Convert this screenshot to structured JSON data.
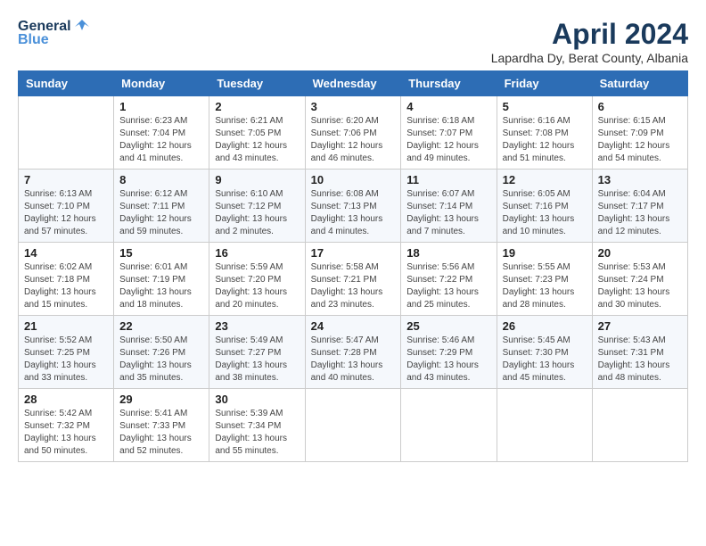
{
  "header": {
    "logo_line1": "General",
    "logo_line2": "Blue",
    "title": "April 2024",
    "subtitle": "Lapardha Dy, Berat County, Albania"
  },
  "calendar": {
    "days_of_week": [
      "Sunday",
      "Monday",
      "Tuesday",
      "Wednesday",
      "Thursday",
      "Friday",
      "Saturday"
    ],
    "weeks": [
      [
        {
          "day": "",
          "info": ""
        },
        {
          "day": "1",
          "info": "Sunrise: 6:23 AM\nSunset: 7:04 PM\nDaylight: 12 hours\nand 41 minutes."
        },
        {
          "day": "2",
          "info": "Sunrise: 6:21 AM\nSunset: 7:05 PM\nDaylight: 12 hours\nand 43 minutes."
        },
        {
          "day": "3",
          "info": "Sunrise: 6:20 AM\nSunset: 7:06 PM\nDaylight: 12 hours\nand 46 minutes."
        },
        {
          "day": "4",
          "info": "Sunrise: 6:18 AM\nSunset: 7:07 PM\nDaylight: 12 hours\nand 49 minutes."
        },
        {
          "day": "5",
          "info": "Sunrise: 6:16 AM\nSunset: 7:08 PM\nDaylight: 12 hours\nand 51 minutes."
        },
        {
          "day": "6",
          "info": "Sunrise: 6:15 AM\nSunset: 7:09 PM\nDaylight: 12 hours\nand 54 minutes."
        }
      ],
      [
        {
          "day": "7",
          "info": "Sunrise: 6:13 AM\nSunset: 7:10 PM\nDaylight: 12 hours\nand 57 minutes."
        },
        {
          "day": "8",
          "info": "Sunrise: 6:12 AM\nSunset: 7:11 PM\nDaylight: 12 hours\nand 59 minutes."
        },
        {
          "day": "9",
          "info": "Sunrise: 6:10 AM\nSunset: 7:12 PM\nDaylight: 13 hours\nand 2 minutes."
        },
        {
          "day": "10",
          "info": "Sunrise: 6:08 AM\nSunset: 7:13 PM\nDaylight: 13 hours\nand 4 minutes."
        },
        {
          "day": "11",
          "info": "Sunrise: 6:07 AM\nSunset: 7:14 PM\nDaylight: 13 hours\nand 7 minutes."
        },
        {
          "day": "12",
          "info": "Sunrise: 6:05 AM\nSunset: 7:16 PM\nDaylight: 13 hours\nand 10 minutes."
        },
        {
          "day": "13",
          "info": "Sunrise: 6:04 AM\nSunset: 7:17 PM\nDaylight: 13 hours\nand 12 minutes."
        }
      ],
      [
        {
          "day": "14",
          "info": "Sunrise: 6:02 AM\nSunset: 7:18 PM\nDaylight: 13 hours\nand 15 minutes."
        },
        {
          "day": "15",
          "info": "Sunrise: 6:01 AM\nSunset: 7:19 PM\nDaylight: 13 hours\nand 18 minutes."
        },
        {
          "day": "16",
          "info": "Sunrise: 5:59 AM\nSunset: 7:20 PM\nDaylight: 13 hours\nand 20 minutes."
        },
        {
          "day": "17",
          "info": "Sunrise: 5:58 AM\nSunset: 7:21 PM\nDaylight: 13 hours\nand 23 minutes."
        },
        {
          "day": "18",
          "info": "Sunrise: 5:56 AM\nSunset: 7:22 PM\nDaylight: 13 hours\nand 25 minutes."
        },
        {
          "day": "19",
          "info": "Sunrise: 5:55 AM\nSunset: 7:23 PM\nDaylight: 13 hours\nand 28 minutes."
        },
        {
          "day": "20",
          "info": "Sunrise: 5:53 AM\nSunset: 7:24 PM\nDaylight: 13 hours\nand 30 minutes."
        }
      ],
      [
        {
          "day": "21",
          "info": "Sunrise: 5:52 AM\nSunset: 7:25 PM\nDaylight: 13 hours\nand 33 minutes."
        },
        {
          "day": "22",
          "info": "Sunrise: 5:50 AM\nSunset: 7:26 PM\nDaylight: 13 hours\nand 35 minutes."
        },
        {
          "day": "23",
          "info": "Sunrise: 5:49 AM\nSunset: 7:27 PM\nDaylight: 13 hours\nand 38 minutes."
        },
        {
          "day": "24",
          "info": "Sunrise: 5:47 AM\nSunset: 7:28 PM\nDaylight: 13 hours\nand 40 minutes."
        },
        {
          "day": "25",
          "info": "Sunrise: 5:46 AM\nSunset: 7:29 PM\nDaylight: 13 hours\nand 43 minutes."
        },
        {
          "day": "26",
          "info": "Sunrise: 5:45 AM\nSunset: 7:30 PM\nDaylight: 13 hours\nand 45 minutes."
        },
        {
          "day": "27",
          "info": "Sunrise: 5:43 AM\nSunset: 7:31 PM\nDaylight: 13 hours\nand 48 minutes."
        }
      ],
      [
        {
          "day": "28",
          "info": "Sunrise: 5:42 AM\nSunset: 7:32 PM\nDaylight: 13 hours\nand 50 minutes."
        },
        {
          "day": "29",
          "info": "Sunrise: 5:41 AM\nSunset: 7:33 PM\nDaylight: 13 hours\nand 52 minutes."
        },
        {
          "day": "30",
          "info": "Sunrise: 5:39 AM\nSunset: 7:34 PM\nDaylight: 13 hours\nand 55 minutes."
        },
        {
          "day": "",
          "info": ""
        },
        {
          "day": "",
          "info": ""
        },
        {
          "day": "",
          "info": ""
        },
        {
          "day": "",
          "info": ""
        }
      ]
    ]
  }
}
